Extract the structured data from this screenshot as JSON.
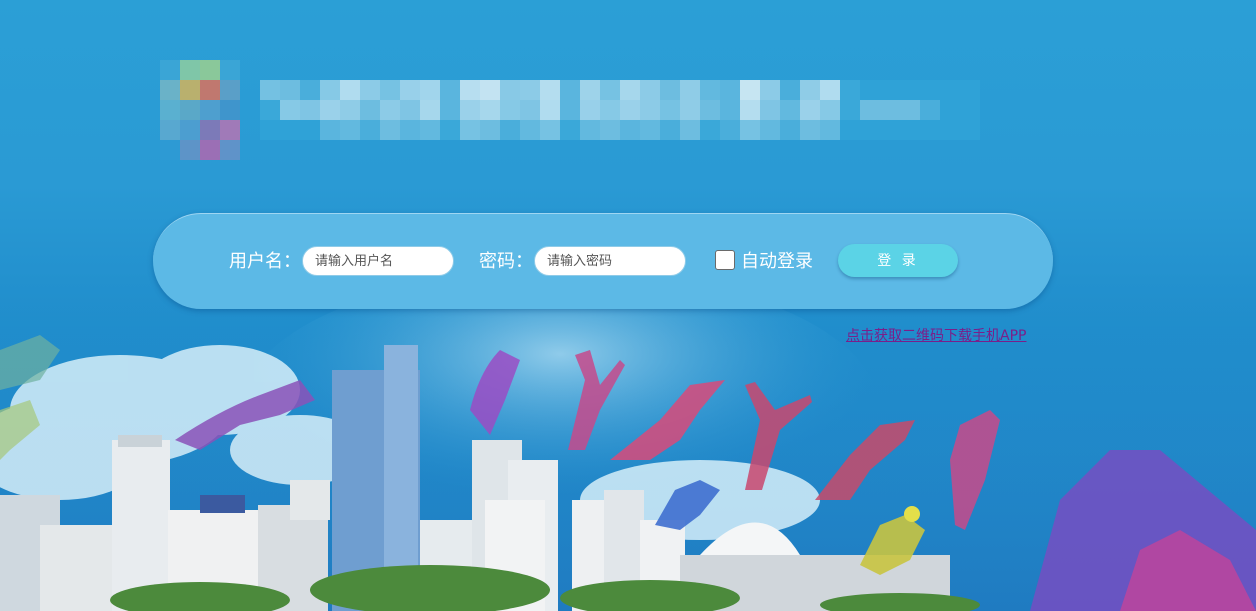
{
  "login": {
    "username_label": "用户名：",
    "username_placeholder": "请输入用户名",
    "password_label": "密码：",
    "password_placeholder": "请输入密码",
    "remember_label": "自动登录",
    "login_button": "登 录"
  },
  "qr_link": "点击获取二维码下载手机APP",
  "colors": {
    "background": "#2a9ad4",
    "login_bar": "#5cb9e6",
    "login_button": "#5bd3e6",
    "link": "#7a1f8a"
  },
  "icons": [
    "blurred-logo-image",
    "blurred-title-image",
    "city-skyline-image",
    "athlete-silhouettes-image"
  ]
}
